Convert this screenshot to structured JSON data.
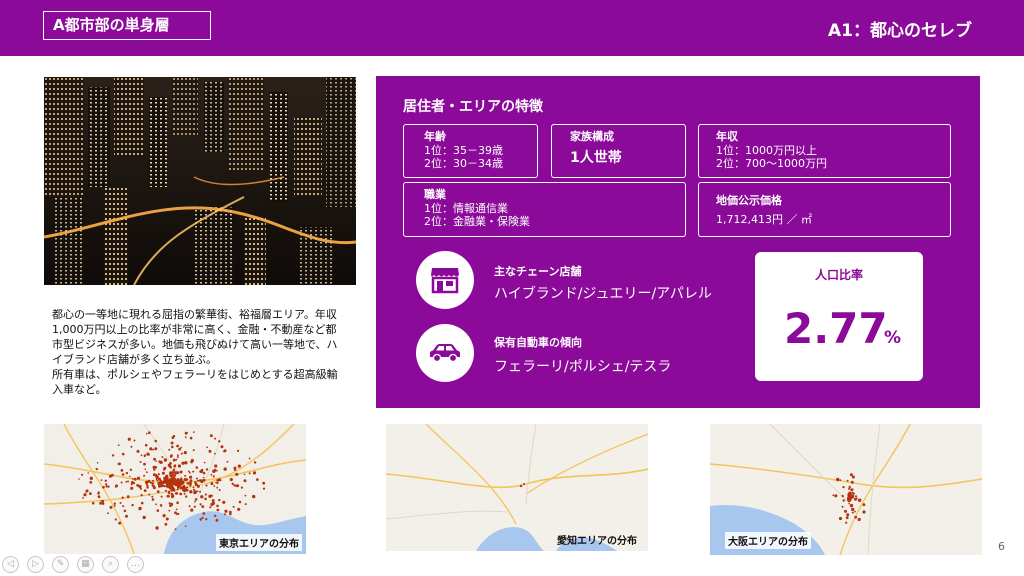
{
  "header": {
    "title": "A都市部の単身層",
    "segment": "A1：都心のセレブ"
  },
  "description": {
    "lines": [
      "都心の一等地に現れる屈指の繁華街、裕福層エリア。年収",
      "1,000万円以上の比率が非常に高く、金融・不動産など都",
      "市型ビジネスが多い。地価も飛びぬけて高い一等地で、ハ",
      "イブランド店舗が多く立ち並ぶ。",
      "所有車は、ポルシェやフェラーリをはじめとする超高級輸",
      "入車など。"
    ]
  },
  "panel": {
    "title": "居住者・エリアの特徴",
    "age": {
      "label": "年齢",
      "rank1": "1位：35－39歳",
      "rank2": "2位：30－34歳"
    },
    "family": {
      "label": "家族構成",
      "value": "1人世帯"
    },
    "income": {
      "label": "年収",
      "rank1": "1位：1000万円以上",
      "rank2": "2位：700～1000万円"
    },
    "occupation": {
      "label": "職業",
      "rank1": "1位：情報通信業",
      "rank2": "2位：金融業・保険業"
    },
    "land_price": {
      "label": "地価公示価格",
      "value": "1,712,413円 ／ ㎡"
    },
    "chain_stores": {
      "label": "主なチェーン店舗",
      "value": "ハイブランド/ジュエリー/アパレル",
      "icon": "store-icon"
    },
    "cars": {
      "label": "保有自動車の傾向",
      "value": "フェラーリ/ポルシェ/テスラ",
      "icon": "car-icon"
    },
    "population_ratio": {
      "label": "人口比率",
      "value": "2.77",
      "unit": "%"
    }
  },
  "maps": {
    "tokyo": "東京エリアの分布",
    "aichi": "愛知エリアの分布",
    "osaka": "大阪エリアの分布"
  },
  "slide_number": "6",
  "colors": {
    "brand": "#8B0A99",
    "dots": "#B5330F"
  }
}
